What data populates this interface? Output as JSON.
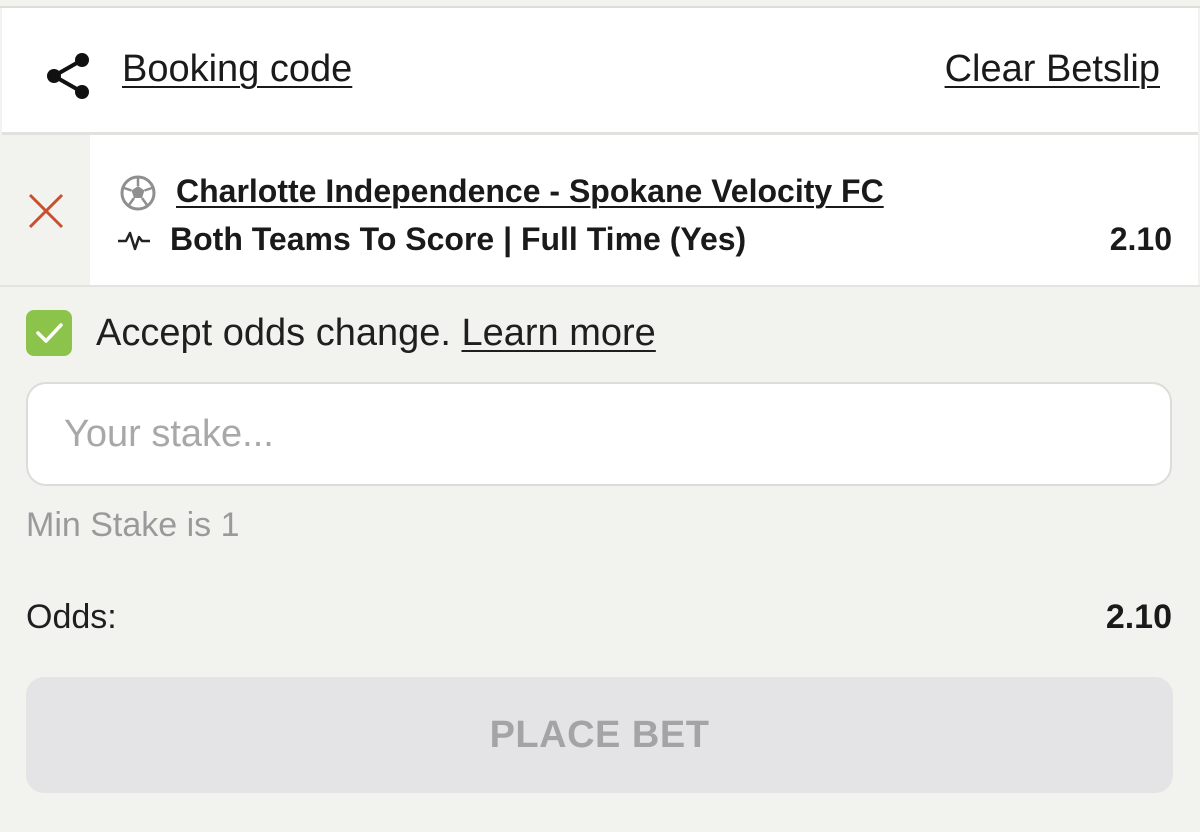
{
  "header": {
    "share_icon": "share-icon",
    "booking_code_label": "Booking code",
    "clear_betslip_label": "Clear Betslip"
  },
  "bet": {
    "remove_icon": "close-icon",
    "sport_icon": "soccer-ball-icon",
    "match": "Charlotte Independence - Spokane Velocity FC",
    "market_icon": "activity-pulse-icon",
    "market": "Both Teams To Score | Full Time (Yes)",
    "odds": "2.10"
  },
  "accept_odds": {
    "checked": true,
    "label": "Accept odds change.",
    "learn_more": "Learn more"
  },
  "stake": {
    "placeholder": "Your stake...",
    "value": "",
    "min_stake_text": "Min Stake is 1"
  },
  "summary": {
    "odds_label": "Odds:",
    "odds_value": "2.10"
  },
  "place_bet": {
    "label": "PLACE BET",
    "enabled": false
  },
  "colors": {
    "background": "#f2f2ee",
    "checkbox_green": "#8cc34a",
    "remove_red": "#c8502f",
    "disabled_button": "#e4e4e6"
  }
}
